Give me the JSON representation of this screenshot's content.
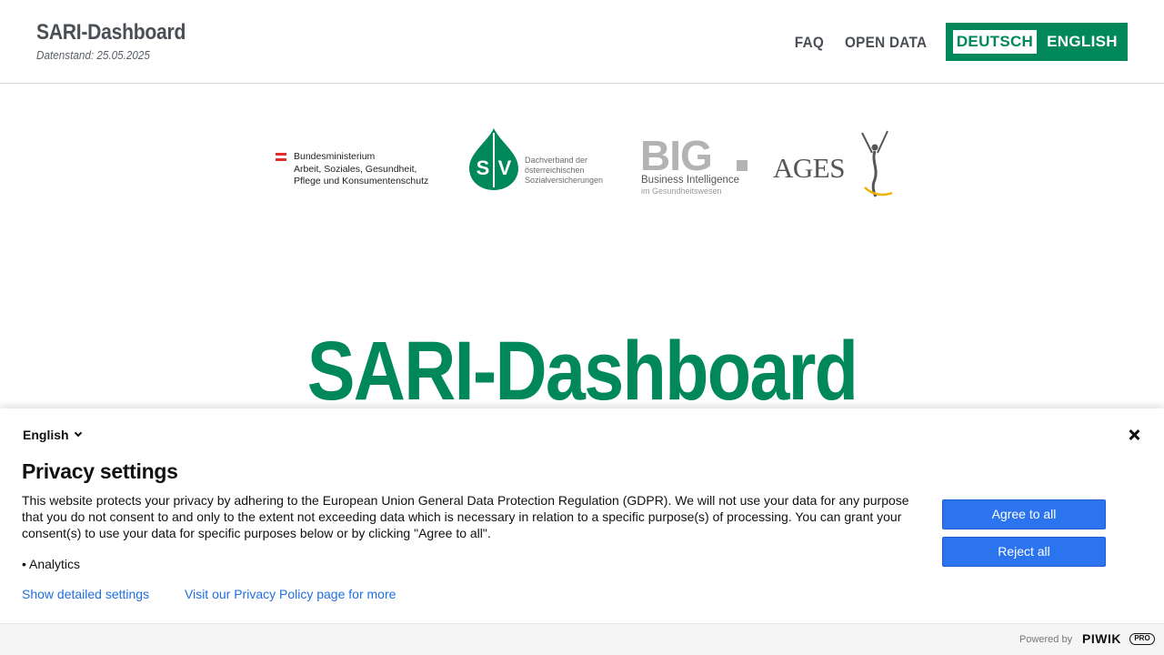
{
  "header": {
    "title": "SARI-Dashboard",
    "date_label": "Datenstand: 25.05.2025",
    "nav": {
      "faq": "FAQ",
      "open_data": "OPEN DATA"
    },
    "languages": {
      "de": "DEUTSCH",
      "en": "ENGLISH"
    }
  },
  "logos": {
    "ministry": {
      "line1": "Bundesministerium",
      "line2": "Arbeit, Soziales, Gesundheit,",
      "line3": "Pflege und Konsumentenschutz"
    },
    "sv": {
      "mark": "SV",
      "line1": "Dachverband der",
      "line2": "österreichischen",
      "line3": "Sozialversicherungen"
    },
    "big": {
      "word": "BIG",
      "sub1": "Business Intelligence",
      "sub2": "im Gesundheitswesen"
    },
    "ages": {
      "word": "AGES"
    }
  },
  "hero": {
    "title": "SARI-Dashboard"
  },
  "privacy": {
    "language": "English",
    "title": "Privacy settings",
    "text": "This website protects your privacy by adhering to the European Union General Data Protection Regulation (GDPR). We will not use your data for any purpose that you do not consent to and only to the extent not exceeding data which is necessary in relation to a specific purpose(s) of processing. You can grant your consent(s) to use your data for specific purposes below or by clicking \"Agree to all\".",
    "bullet": "• Analytics",
    "link_settings": "Show detailed settings",
    "link_policy": "Visit our Privacy Policy page for more",
    "agree": "Agree to all",
    "reject": "Reject all",
    "powered_by": "Powered by",
    "piwik": "PIWIK",
    "pro": "PRO"
  },
  "colors": {
    "brand_green": "#00875a",
    "button_blue": "#2b74ee",
    "link_blue": "#1f6fe0"
  }
}
